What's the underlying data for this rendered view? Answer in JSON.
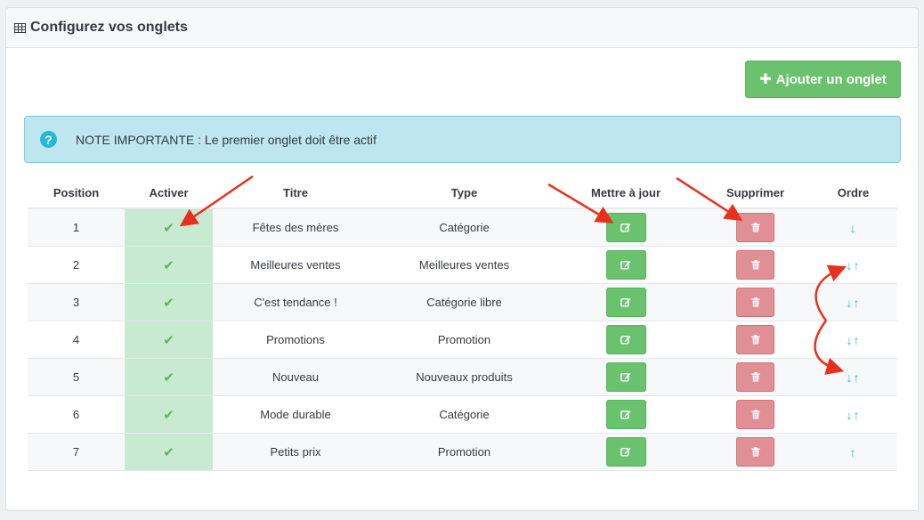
{
  "panel": {
    "title": "Configurez vos onglets",
    "title_icon": "table-icon"
  },
  "toolbar": {
    "add_label": "Ajouter un onglet",
    "add_icon": "plus-icon"
  },
  "alert": {
    "text": "NOTE IMPORTANTE : Le premier onglet doit être actif",
    "icon": "question-circle-icon"
  },
  "table": {
    "headers": [
      "Position",
      "Activer",
      "Titre",
      "Type",
      "Mettre à jour",
      "Supprimer",
      "Ordre"
    ],
    "rows": [
      {
        "position": "1",
        "title": "Fêtes des mères",
        "type": "Catégorie",
        "down": true,
        "up": false
      },
      {
        "position": "2",
        "title": "Meilleures ventes",
        "type": "Meilleures ventes",
        "down": true,
        "up": true
      },
      {
        "position": "3",
        "title": "C'est tendance !",
        "type": "Catégorie libre",
        "down": true,
        "up": true
      },
      {
        "position": "4",
        "title": "Promotions",
        "type": "Promotion",
        "down": true,
        "up": true
      },
      {
        "position": "5",
        "title": "Nouveau",
        "type": "Nouveaux produits",
        "down": true,
        "up": true
      },
      {
        "position": "6",
        "title": "Mode durable",
        "type": "Catégorie",
        "down": true,
        "up": true
      },
      {
        "position": "7",
        "title": "Petits prix",
        "type": "Promotion",
        "down": false,
        "up": true
      }
    ]
  },
  "colors": {
    "success": "#6ac16e",
    "danger": "#e08f95",
    "info": "#25b9d7",
    "annotation": "#e8311d"
  }
}
